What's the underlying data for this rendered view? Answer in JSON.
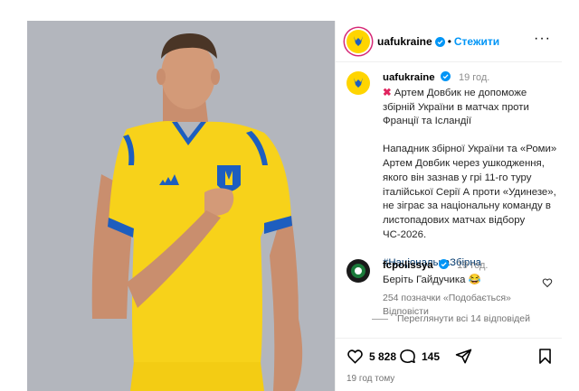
{
  "post": {
    "username": "uafukraine",
    "follow_label": "Стежити",
    "separator": "•",
    "more_label": "···"
  },
  "caption": {
    "username": "uafukraine",
    "time": "19 год.",
    "headline": "Артем Довбик не допоможе збірній України в матчах проти Франції та Ісландії",
    "body": "Нападник збірної України та «Роми» Артем Довбик через ушкодження, якого він зазнав у грі 11-го туру італійської Серії А проти «Удинезе», не зіграє за національну команду в листопадових матчах відбору ЧС-2026.",
    "hashtag": "#НаціональнаЗбірна"
  },
  "comment": {
    "username": "fcpolissya",
    "time": "19 год.",
    "text": "Беріть Гайдучика 😂",
    "likes": "254 позначки «Подобається»",
    "reply_label": "Відповісти"
  },
  "view_replies": "Переглянути всі 14 відповідей",
  "actions": {
    "likes": "5 828",
    "comments": "145"
  },
  "posted_ago": "19 год тому",
  "colors": {
    "accent": "#0095f6",
    "verified": "#0095f6",
    "jersey_yellow": "#f7d21a",
    "jersey_blue": "#1d5ebf",
    "background": "#b3b6bd"
  },
  "icons": [
    "verified-icon",
    "more-icon",
    "cross-mark-icon",
    "heart-icon",
    "comment-icon",
    "share-icon",
    "bookmark-icon"
  ]
}
